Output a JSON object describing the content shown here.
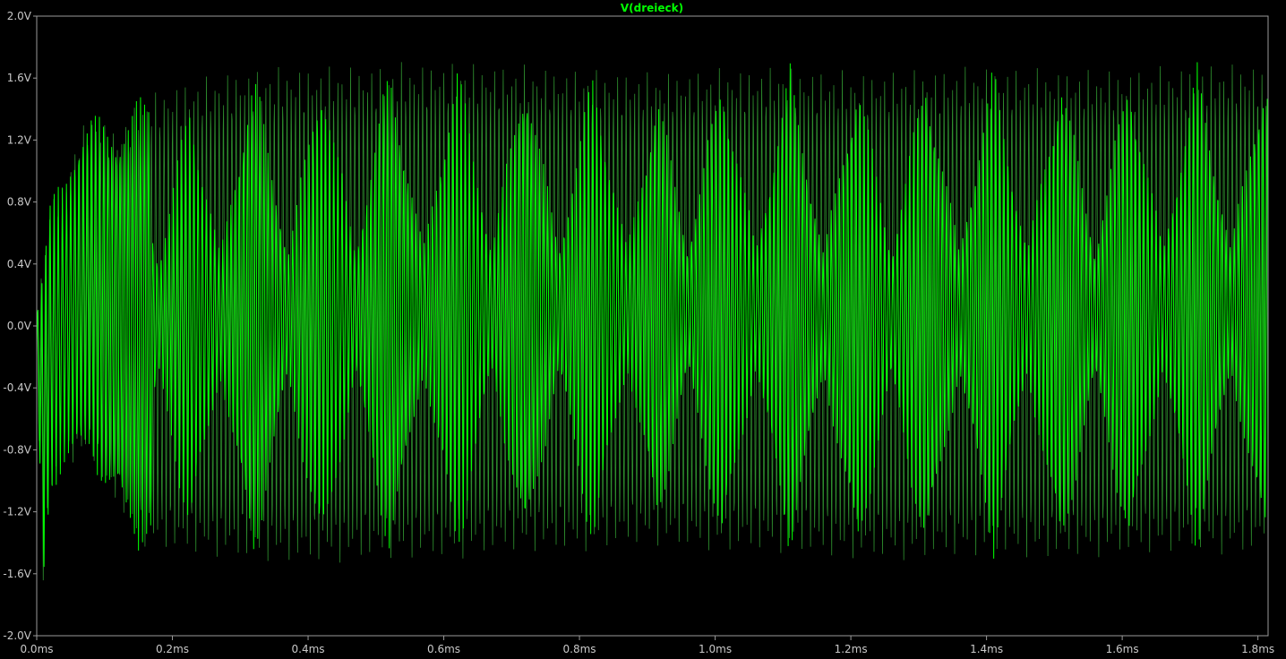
{
  "chart_data": {
    "type": "line",
    "title": "",
    "xlabel": "",
    "ylabel": "",
    "xlim": [
      0,
      1.815
    ],
    "ylim": [
      -2.0,
      2.0
    ],
    "x_ticks": [
      {
        "value": 0.0,
        "label": "0.0ms"
      },
      {
        "value": 0.2,
        "label": "0.2ms"
      },
      {
        "value": 0.4,
        "label": "0.4ms"
      },
      {
        "value": 0.6,
        "label": "0.6ms"
      },
      {
        "value": 0.8,
        "label": "0.8ms"
      },
      {
        "value": 1.0,
        "label": "1.0ms"
      },
      {
        "value": 1.2,
        "label": "1.2ms"
      },
      {
        "value": 1.4,
        "label": "1.4ms"
      },
      {
        "value": 1.6,
        "label": "1.6ms"
      },
      {
        "value": 1.8,
        "label": "1.8ms"
      }
    ],
    "y_ticks": [
      {
        "value": 2.0,
        "label": "2.0V"
      },
      {
        "value": 1.6,
        "label": "1.6V"
      },
      {
        "value": 1.2,
        "label": "1.2V"
      },
      {
        "value": 0.8,
        "label": "0.8V"
      },
      {
        "value": 0.4,
        "label": "0.4V"
      },
      {
        "value": 0.0,
        "label": "0.0V"
      },
      {
        "value": -0.4,
        "label": "-0.4V"
      },
      {
        "value": -0.8,
        "label": "-0.8V"
      },
      {
        "value": -1.2,
        "label": "-1.2V"
      },
      {
        "value": -1.6,
        "label": "-1.6V"
      },
      {
        "value": -2.0,
        "label": "-2.0V"
      }
    ],
    "grid": false,
    "series": [
      {
        "name": "V(dreieck)",
        "color": "#00ff00",
        "x": [
          0.0,
          0.01,
          0.02,
          0.04,
          0.06,
          0.08,
          0.1,
          0.12,
          0.15,
          0.2,
          0.3,
          0.4,
          0.5,
          0.6,
          0.7,
          0.8,
          0.9,
          1.0,
          1.1,
          1.2,
          1.3,
          1.4,
          1.5,
          1.6,
          1.7,
          1.8,
          1.815
        ],
        "upper_envelope": [
          0.1,
          0.5,
          0.85,
          0.95,
          1.25,
          1.4,
          1.35,
          1.3,
          1.5,
          1.6,
          1.7,
          1.72,
          1.73,
          1.75,
          1.73,
          1.7,
          1.68,
          1.7,
          1.72,
          1.68,
          1.7,
          1.72,
          1.7,
          1.7,
          1.72,
          1.75,
          1.62
        ],
        "lower_envelope": [
          -0.3,
          -1.75,
          -1.1,
          -0.95,
          -0.9,
          -0.85,
          -1.1,
          -1.2,
          -1.45,
          -1.5,
          -1.55,
          -1.58,
          -1.55,
          -1.55,
          -1.5,
          -1.5,
          -1.45,
          -1.5,
          -1.5,
          -1.55,
          -1.55,
          -1.52,
          -1.55,
          -1.52,
          -1.5,
          -1.52,
          -1.4
        ],
        "beat_nodes_ms": [
          0.18,
          0.27,
          0.37,
          0.47,
          0.57,
          0.67,
          0.77,
          0.87,
          0.96,
          1.06,
          1.16,
          1.26,
          1.36,
          1.46,
          1.56,
          1.66,
          1.76
        ]
      }
    ]
  }
}
